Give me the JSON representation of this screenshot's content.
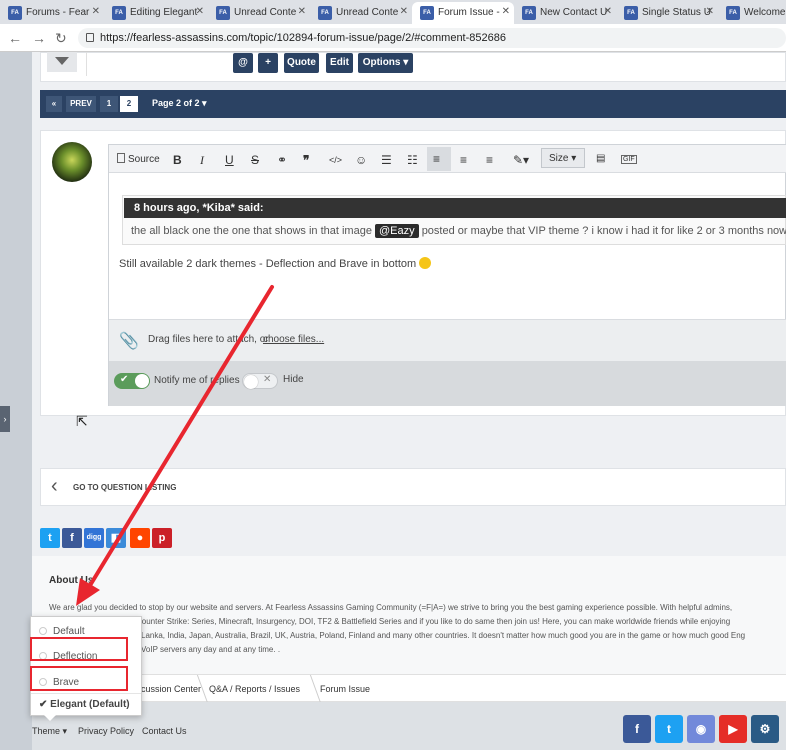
{
  "browser": {
    "tabs": [
      {
        "label": "Forums - Fear"
      },
      {
        "label": "Editing Elegant"
      },
      {
        "label": "Unread Conte"
      },
      {
        "label": "Unread Conte"
      },
      {
        "label": "Forum Issue -"
      },
      {
        "label": "New Contact U"
      },
      {
        "label": "Single Status U"
      },
      {
        "label": "Welcome to"
      }
    ],
    "favicon_text": "FA",
    "url": "https://fearless-assassins.com/topic/102894-forum-issue/page/2/#comment-852686"
  },
  "post_actions": {
    "mention": "@",
    "plus": "+",
    "quote": "Quote",
    "edit": "Edit",
    "options": "Options ▾"
  },
  "pagination": {
    "first": "«",
    "prev": "PREV",
    "page1": "1",
    "page2": "2",
    "page_of": "Page 2 of 2 ▾"
  },
  "editor": {
    "source": "Source",
    "bold": "B",
    "italic": "I",
    "underline": "U",
    "strike": "S",
    "size": "Size ▾",
    "quote_header": "8 hours ago, *Kiba* said:",
    "quote_text_1": "the all black one the one that shows in that image",
    "mention_tag": "@Eazy",
    "quote_text_2": "posted or maybe that  VIP theme ? i know i had it for  like 2 or 3 months now",
    "reply_text": "Still available 2 dark themes - Deflection and Brave in bottom",
    "attach_text": "Drag files here to attach, or",
    "choose_files": "choose files...",
    "notify_label": "Notify me of replies",
    "hide_label": "Hide"
  },
  "go_to_question": "GO TO QUESTION LISTING",
  "about": {
    "title": "About Us",
    "line1": "We are glad you decided to stop by our website and servers. At Fearless Assassins Gaming Community (=F|A=) we strive to bring you the best gaming experience possible. With helpful admins,",
    "line2": "VIP, Call of Duty Series, Counter Strike: Series, Minecraft, Insurgency, DOI, TF2 & Battlefield Series and if you like to do same then join us! Here, you can make worldwide friends while enjoying",
    "line3": "Lanka, India, Japan, Australia, Brazil, UK, Austria, Poland, Finland and many other countries. It doesn't matter how much good you are in the game or how much good Eng",
    "line4": "VoIP servers any day and at any time. ."
  },
  "breadcrumb": {
    "item1": "Discussion Center",
    "item2": "Q&A / Reports / Issues",
    "item3": "Forum Issue"
  },
  "theme_menu": {
    "items": [
      "Default",
      "Deflection",
      "Brave"
    ],
    "selected": "✔ Elegant (Default)"
  },
  "footer": {
    "theme": "Theme ▾",
    "privacy": "Privacy Policy",
    "contact": "Contact Us"
  },
  "colors": {
    "navy": "#2b4263",
    "annotation_red": "#e8262f",
    "toggle_green": "#5b9c5b"
  }
}
